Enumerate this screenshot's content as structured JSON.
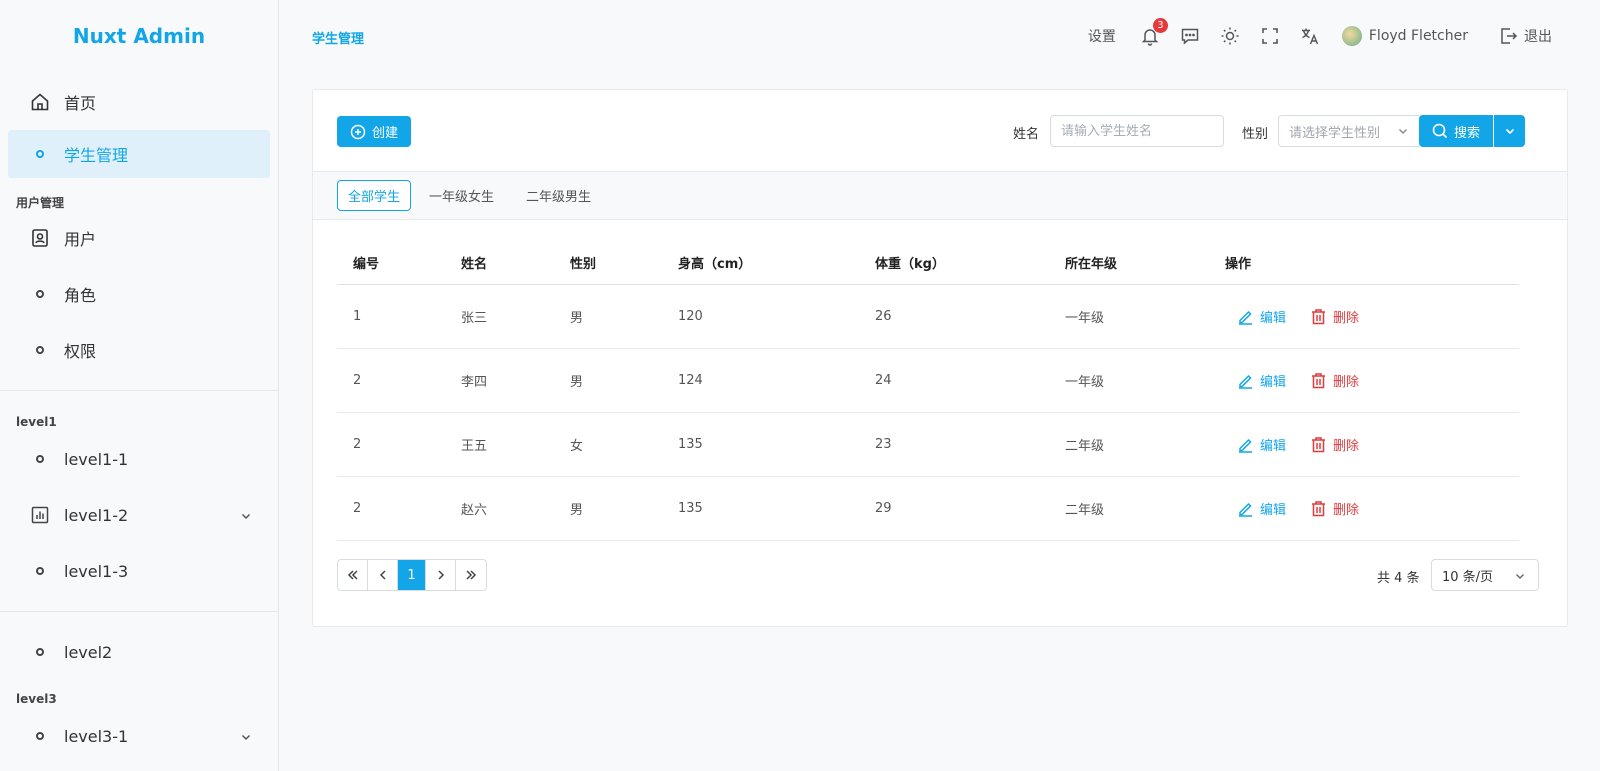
{
  "app": {
    "title": "Nuxt Admin"
  },
  "sidebar": {
    "home": "首页",
    "students": "学生管理",
    "group_user_mgmt": "用户管理",
    "users": "用户",
    "roles": "角色",
    "permissions": "权限",
    "group_level1": "level1",
    "level1_1": "level1-1",
    "level1_2": "level1-2",
    "level1_3": "level1-3",
    "level2": "level2",
    "group_level3": "level3",
    "level3_1": "level3-1"
  },
  "header": {
    "breadcrumb": "学生管理",
    "settings": "设置",
    "notification_count": "3",
    "username": "Floyd Fletcher",
    "logout": "退出"
  },
  "toolbar": {
    "create_label": "创建",
    "name_label": "姓名",
    "name_placeholder": "请输入学生姓名",
    "gender_label": "性别",
    "gender_placeholder": "请选择学生性别",
    "search_label": "搜索"
  },
  "tabs": [
    "全部学生",
    "一年级女生",
    "二年级男生"
  ],
  "table": {
    "columns": [
      "编号",
      "姓名",
      "性别",
      "身高（cm）",
      "体重（kg）",
      "所在年级",
      "操作"
    ],
    "rows": [
      {
        "id": "1",
        "name": "张三",
        "gender": "男",
        "height": "120",
        "weight": "26",
        "grade": "一年级"
      },
      {
        "id": "2",
        "name": "李四",
        "gender": "男",
        "height": "124",
        "weight": "24",
        "grade": "一年级"
      },
      {
        "id": "2",
        "name": "王五",
        "gender": "女",
        "height": "135",
        "weight": "23",
        "grade": "二年级"
      },
      {
        "id": "2",
        "name": "赵六",
        "gender": "男",
        "height": "135",
        "weight": "29",
        "grade": "二年级"
      }
    ],
    "edit_label": "编辑",
    "delete_label": "删除"
  },
  "pagination": {
    "current_page": "1",
    "total_label": "共 4 条",
    "page_size": "10 条/页"
  },
  "colors": {
    "accent": "#12a6e8",
    "danger": "#e5393b"
  }
}
